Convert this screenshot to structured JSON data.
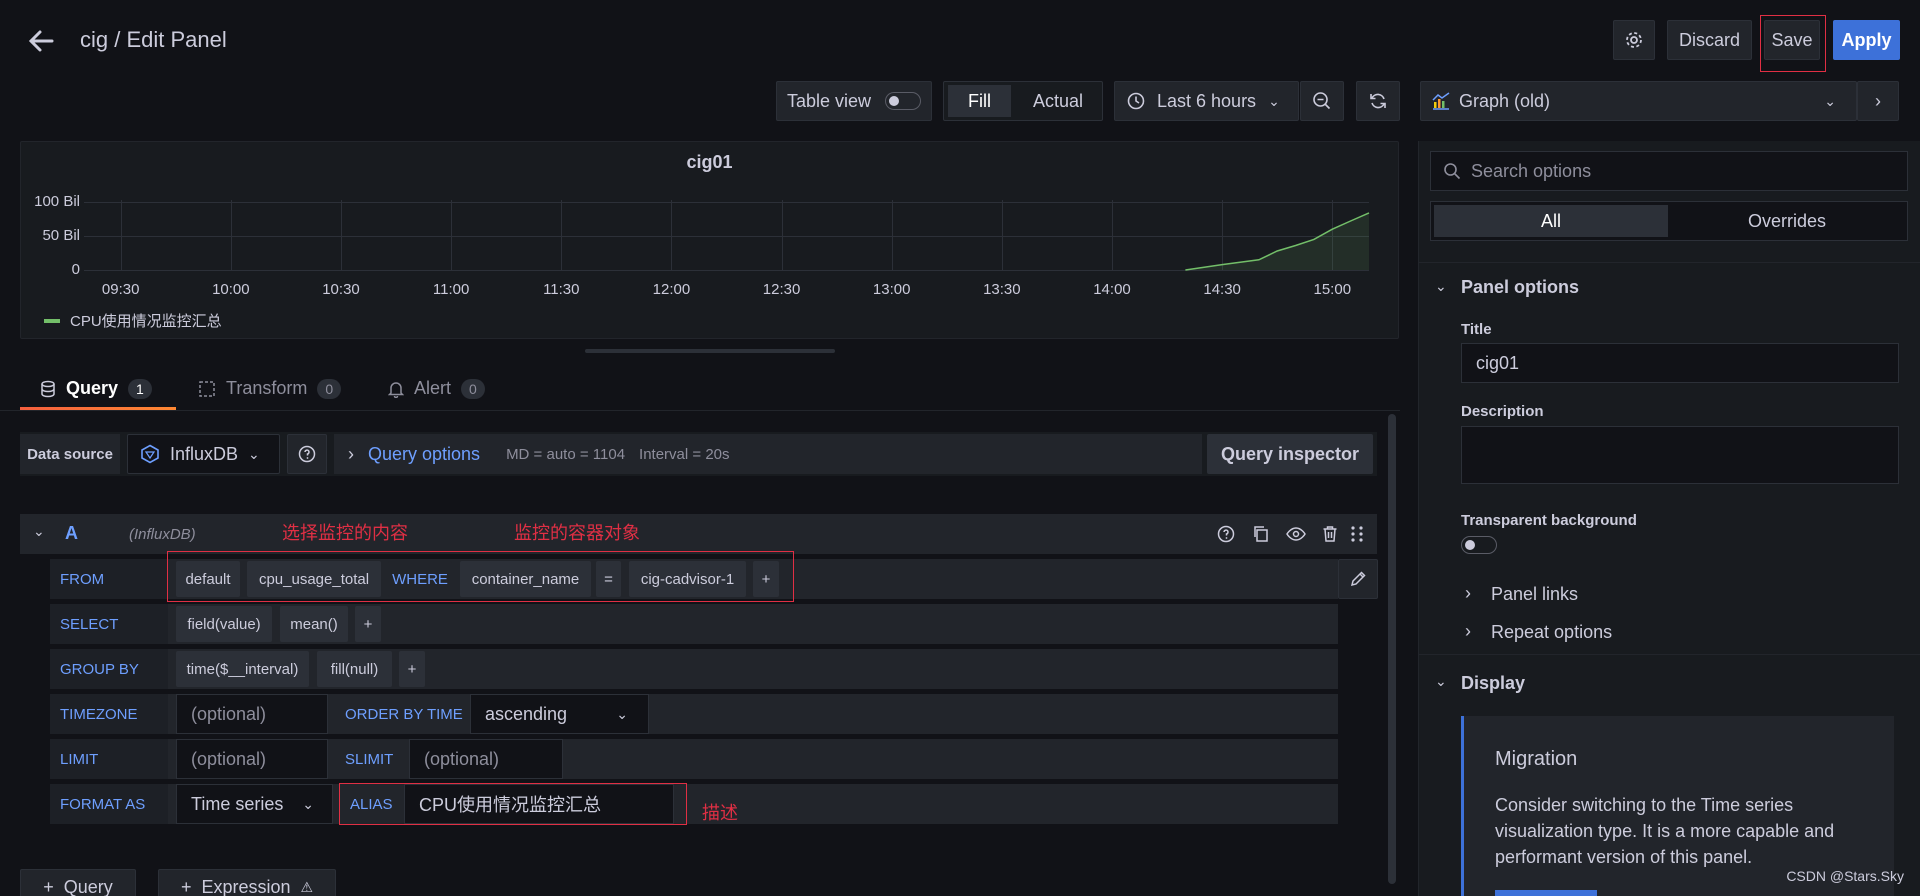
{
  "header": {
    "breadcrumb": "cig / Edit Panel",
    "discard_label": "Discard",
    "save_label": "Save",
    "apply_label": "Apply"
  },
  "toolbar": {
    "table_view_label": "Table view",
    "fill_label": "Fill",
    "actual_label": "Actual",
    "time_range": "Last 6 hours",
    "viz_label": "Graph (old)"
  },
  "chart_data": {
    "type": "line",
    "title": "cig01",
    "y_ticks": [
      "100 Bil",
      "50 Bil",
      "0"
    ],
    "x_ticks": [
      "09:30",
      "10:00",
      "10:30",
      "11:00",
      "11:30",
      "12:00",
      "12:30",
      "13:00",
      "13:30",
      "14:00",
      "14:30",
      "15:00"
    ],
    "series": [
      {
        "name": "CPU使用情况监控汇总",
        "color": "#73bf69",
        "points": [
          [
            "14:20",
            0
          ],
          [
            "14:30",
            8
          ],
          [
            "14:40",
            15
          ],
          [
            "14:45",
            28
          ],
          [
            "14:50",
            36
          ],
          [
            "14:55",
            45
          ],
          [
            "15:00",
            60
          ],
          [
            "15:05",
            72
          ],
          [
            "15:10",
            84
          ]
        ]
      }
    ],
    "ylim": [
      0,
      100
    ],
    "xlim": [
      "09:20",
      "15:10"
    ],
    "unit": "Bil"
  },
  "tabs": [
    {
      "label": "Query",
      "count": "1"
    },
    {
      "label": "Transform",
      "count": "0"
    },
    {
      "label": "Alert",
      "count": "0"
    }
  ],
  "datasource": {
    "label": "Data source",
    "name": "InfluxDB",
    "query_options_label": "Query options",
    "md_info": "MD = auto = 1104",
    "interval_info": "Interval = 20s",
    "inspector_label": "Query inspector"
  },
  "query": {
    "ref": "A",
    "source": "(InfluxDB)",
    "annotation_content": "选择监控的内容",
    "annotation_container": "监控的容器对象",
    "annotation_desc": "描述",
    "from_label": "FROM",
    "from_default": "default",
    "from_measurement": "cpu_usage_total",
    "where_label": "WHERE",
    "where_key": "container_name",
    "where_op": "=",
    "where_value": "cig-cadvisor-1",
    "plus": "+",
    "select_label": "SELECT",
    "select_field": "field(value)",
    "select_fn": "mean()",
    "group_label": "GROUP BY",
    "group_time": "time($__interval)",
    "group_fill": "fill(null)",
    "timezone_label": "TIMEZONE",
    "timezone_placeholder": "(optional)",
    "order_label": "ORDER BY TIME",
    "order_value": "ascending",
    "limit_label": "LIMIT",
    "limit_placeholder": "(optional)",
    "slimit_label": "SLIMIT",
    "slimit_placeholder": "(optional)",
    "format_label": "FORMAT AS",
    "format_value": "Time series",
    "alias_label": "ALIAS",
    "alias_value": "CPU使用情况监控汇总"
  },
  "bottom": {
    "add_query": "Query",
    "add_expression": "Expression"
  },
  "options": {
    "search_placeholder": "Search options",
    "all_tab": "All",
    "overrides_tab": "Overrides",
    "panel_options": "Panel options",
    "title_label": "Title",
    "title_value": "cig01",
    "description_label": "Description",
    "transparent_label": "Transparent background",
    "panel_links": "Panel links",
    "repeat_options": "Repeat options",
    "display": "Display",
    "migration_title": "Migration",
    "migration_text": "Consider switching to the Time series visualization type. It is a more capable and performant version of this panel."
  },
  "watermark": "CSDN @Stars.Sky"
}
